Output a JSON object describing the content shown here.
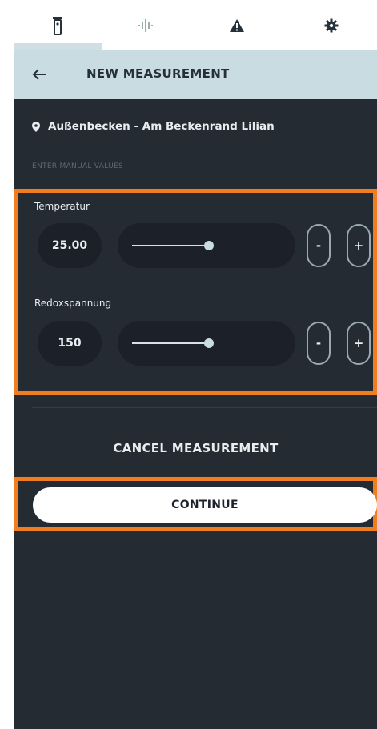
{
  "tabs": [
    {
      "icon": "probe-icon",
      "active": true
    },
    {
      "icon": "signal-icon",
      "active": false
    },
    {
      "icon": "warning-icon",
      "active": false
    },
    {
      "icon": "gear-icon",
      "active": false
    }
  ],
  "header": {
    "title": "NEW MEASUREMENT",
    "back_icon": "arrow-left-icon"
  },
  "location": {
    "icon": "location-pin-icon",
    "text": "Außenbecken - Am Beckenrand Lilian"
  },
  "hint": "ENTER MANUAL VALUES",
  "measurements": [
    {
      "label": "Temperatur",
      "value": "25.00",
      "slider_level": 0.5,
      "minus": "-",
      "plus": "+"
    },
    {
      "label": "Redoxspannung",
      "value": "150",
      "slider_level": 0.5,
      "minus": "-",
      "plus": "+"
    }
  ],
  "cancel_label": "CANCEL MEASUREMENT",
  "continue_label": "CONTINUE",
  "colors": {
    "accent": "#f07d1e",
    "header": "#c9dce2",
    "panel": "#252b33"
  }
}
